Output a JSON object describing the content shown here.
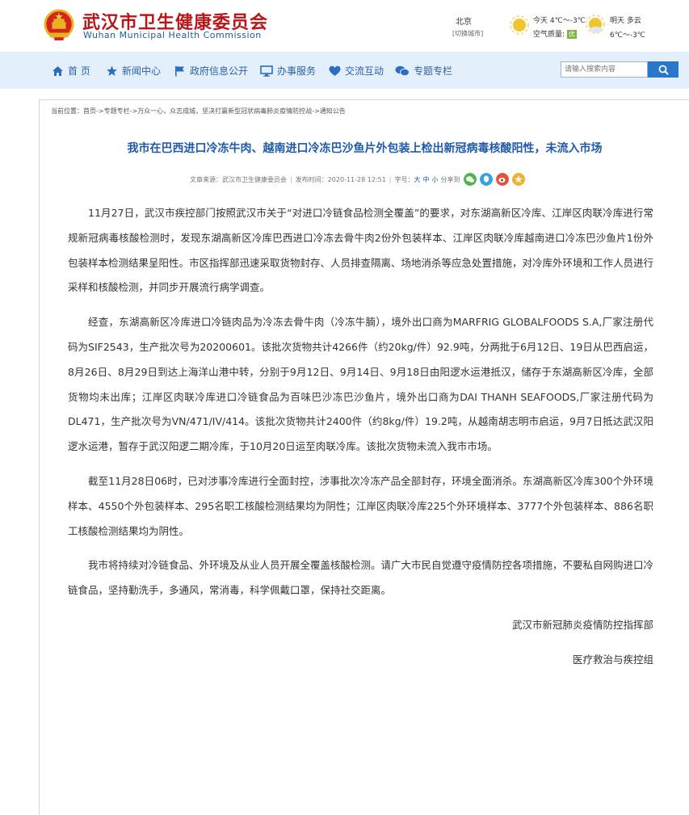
{
  "header": {
    "title_cn": "武汉市卫生健康委员会",
    "title_en": "Wuhan Municipal Health Commission"
  },
  "weather": {
    "city": "北京",
    "switch_city": "[切换城市]",
    "today": "今天  4℃～-3℃",
    "air_quality_label": "空气质量:",
    "air_quality_value": "优",
    "tomorrow": "明天  多云",
    "tomorrow_temp": "6℃～-3℃"
  },
  "nav": {
    "items": [
      {
        "label": "首  页",
        "icon": "home-icon"
      },
      {
        "label": "新闻中心",
        "icon": "star-icon"
      },
      {
        "label": "政府信息公开",
        "icon": "flag-icon"
      },
      {
        "label": "办事服务",
        "icon": "monitor-icon"
      },
      {
        "label": "交流互动",
        "icon": "heart-icon"
      },
      {
        "label": "专题专栏",
        "icon": "chat-bubbles-icon"
      }
    ],
    "search_placeholder": "请输入搜索内容"
  },
  "breadcrumb": {
    "label": "当前位置：",
    "items": [
      "首页",
      "专题专栏",
      "万众一心，众志成城，坚决打赢新型冠状病毒肺炎疫情防控战",
      "通知公告"
    ],
    "separator": "->"
  },
  "article": {
    "title": "我市在巴西进口冷冻牛肉、越南进口冷冻巴沙鱼片外包装上检出新冠病毒核酸阳性，未流入市场",
    "source_label": "文章来源：",
    "source": "武汉市卫生健康委员会",
    "date_label": "发布时间：",
    "date": "2020-11-28 12:51",
    "font_size_label": "字号：",
    "font_sizes": [
      "大",
      "中",
      "小"
    ],
    "share_label": "分享到",
    "paragraphs": [
      "11月27日，武汉市疾控部门按照武汉市关于“对进口冷链食品检测全覆盖”的要求，对东湖高新区冷库、江岸区肉联冷库进行常规新冠病毒核酸检测时，发现东湖高新区冷库巴西进口冷冻去骨牛肉2份外包装样本、江岸区肉联冷库越南进口冷冻巴沙鱼片1份外包装样本检测结果呈阳性。市区指挥部迅速采取货物封存、人员排查隔离、场地消杀等应急处置措施，对冷库外环境和工作人员进行采样和核酸检测，并同步开展流行病学调查。",
      "经查，东湖高新区冷库进口冷链肉品为冷冻去骨牛肉（冷冻牛腩），境外出口商为MARFRIG GLOBALFOODS S.A,厂家注册代码为SIF2543，生产批次号为20200601。该批次货物共计4266件（约20kg/件）92.9吨，分两批于6月12日、19日从巴西启运，8月26日、8月29日到达上海洋山港中转，分别于9月12日、9月14日、9月18日由阳逻水运港抵汉，储存于东湖高新区冷库，全部货物均未出库；江岸区肉联冷库进口冷链食品为百味巴沙冻巴沙鱼片，境外出口商为DAI THANH SEAFOODS,厂家注册代码为DL471，生产批次号为VN/471/IV/414。该批次货物共计2400件（约8kg/件）19.2吨，从越南胡志明市启运，9月7日抵达武汉阳逻水运港，暂存于武汉阳逻二期冷库，于10月20日运至肉联冷库。该批次货物未流入我市市场。",
      "截至11月28日06时，已对涉事冷库进行全面封控，涉事批次冷冻产品全部封存，环境全面消杀。东湖高新区冷库300个外环境样本、4550个外包装样本、295名职工核酸检测结果均为阴性；江岸区肉联冷库225个外环境样本、3777个外包装样本、886名职工核酸检测结果均为阴性。",
      "我市将持续对冷链食品、外环境及从业人员开展全覆盖核酸检测。请广大市民自觉遵守疫情防控各项措施，不要私自网购进口冷链食品，坚持勤洗手，多通风，常消毒，科学佩戴口罩，保持社交距离。"
    ],
    "signature_1": "武汉市新冠肺炎疫情防控指挥部",
    "signature_2": "医疗救治与疾控组"
  },
  "colors": {
    "brand_red": "#b7171b",
    "nav_bg": "#e3f0fb",
    "link_blue": "#2d5fa6",
    "title_blue": "#1e5aa8"
  }
}
